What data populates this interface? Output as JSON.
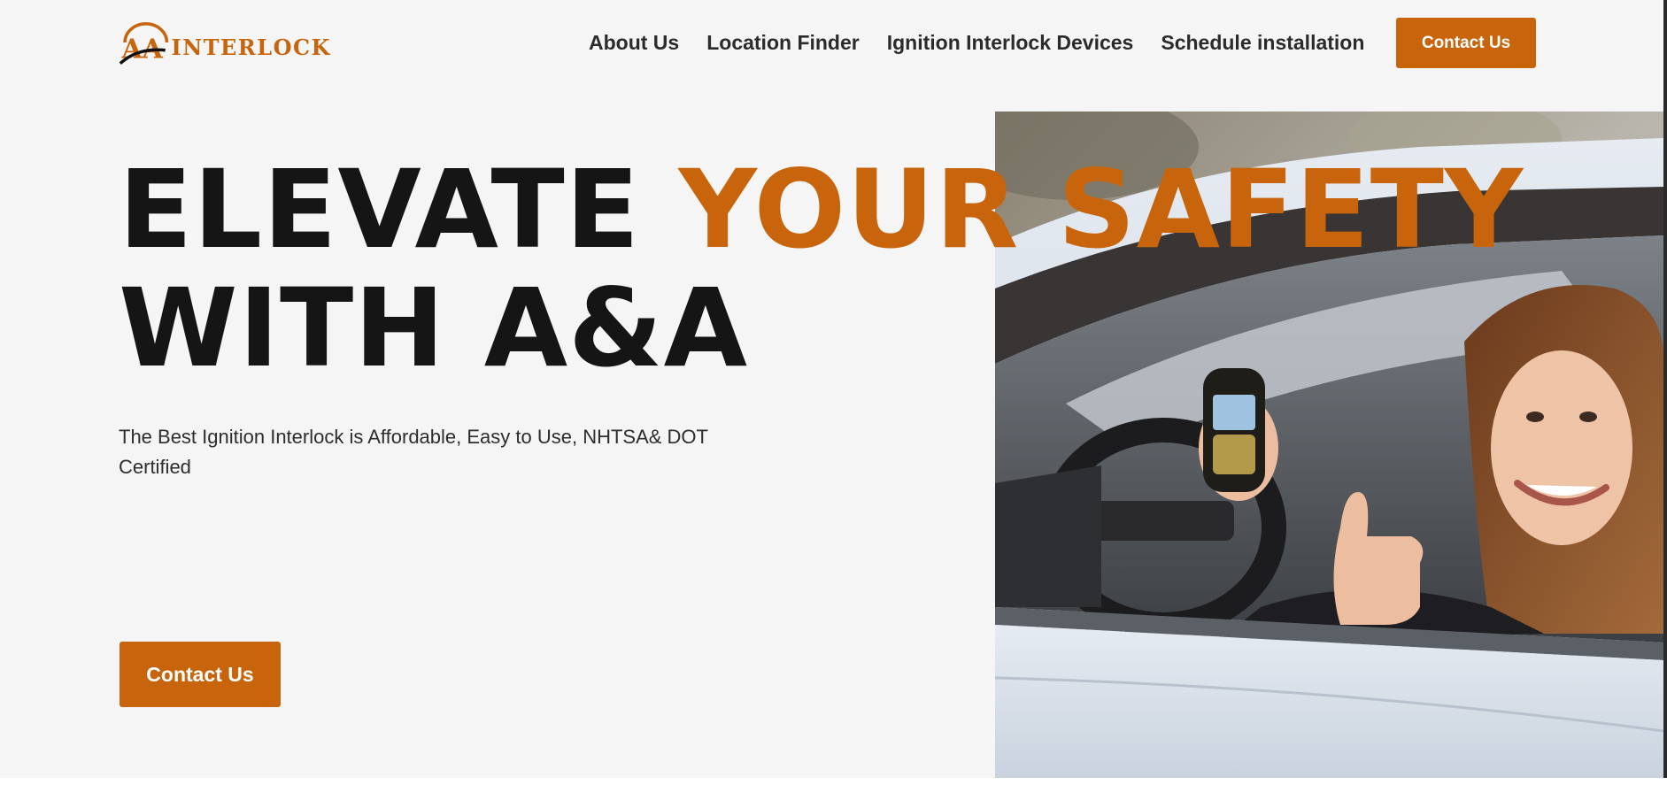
{
  "header": {
    "logo_text": "INTERLOCK",
    "logo_monogram": "AA",
    "nav": [
      {
        "label": "About Us"
      },
      {
        "label": "Location Finder"
      },
      {
        "label": "Ignition Interlock Devices"
      },
      {
        "label": "Schedule installation"
      }
    ],
    "cta_label": "Contact Us"
  },
  "hero": {
    "headline_part1": "ELEVATE ",
    "headline_accent": "YOUR SAFETY",
    "headline_line2": "WITH A&A",
    "subtitle": "The Best Ignition Interlock is Affordable, Easy to Use, NHTSA& DOT Certified",
    "cta_label": "Contact Us",
    "image_icon": "woman-in-car-holding-breathalyzer-photo"
  },
  "colors": {
    "accent": "#c8650c",
    "text_dark": "#151515",
    "background": "#f5f5f5"
  }
}
